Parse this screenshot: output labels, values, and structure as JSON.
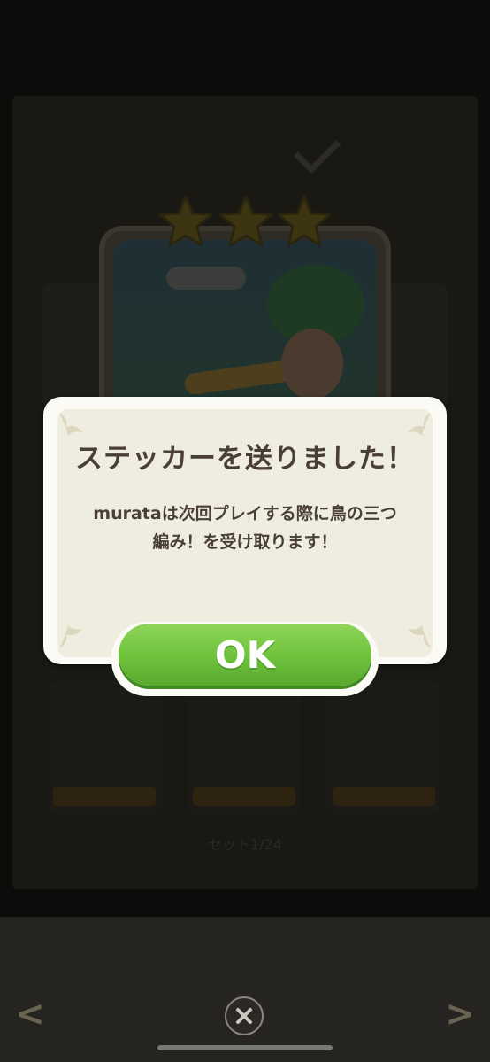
{
  "background": {
    "set_label": "セット1/24",
    "star_count": 3
  },
  "dialog": {
    "title": "ステッカーを送りました！",
    "message_line1": "murataは次回プレイする際に鳥の三つ",
    "message_line2": "編み！を受け取ります！",
    "ok_label": "OK"
  },
  "navigation": {
    "prev_arrow": "<",
    "next_arrow": ">",
    "close_icon": "close-icon"
  },
  "colors": {
    "ok_green": "#6ec13c",
    "dialog_bg": "#fbfaf5",
    "text_dark": "#4a3f38"
  }
}
